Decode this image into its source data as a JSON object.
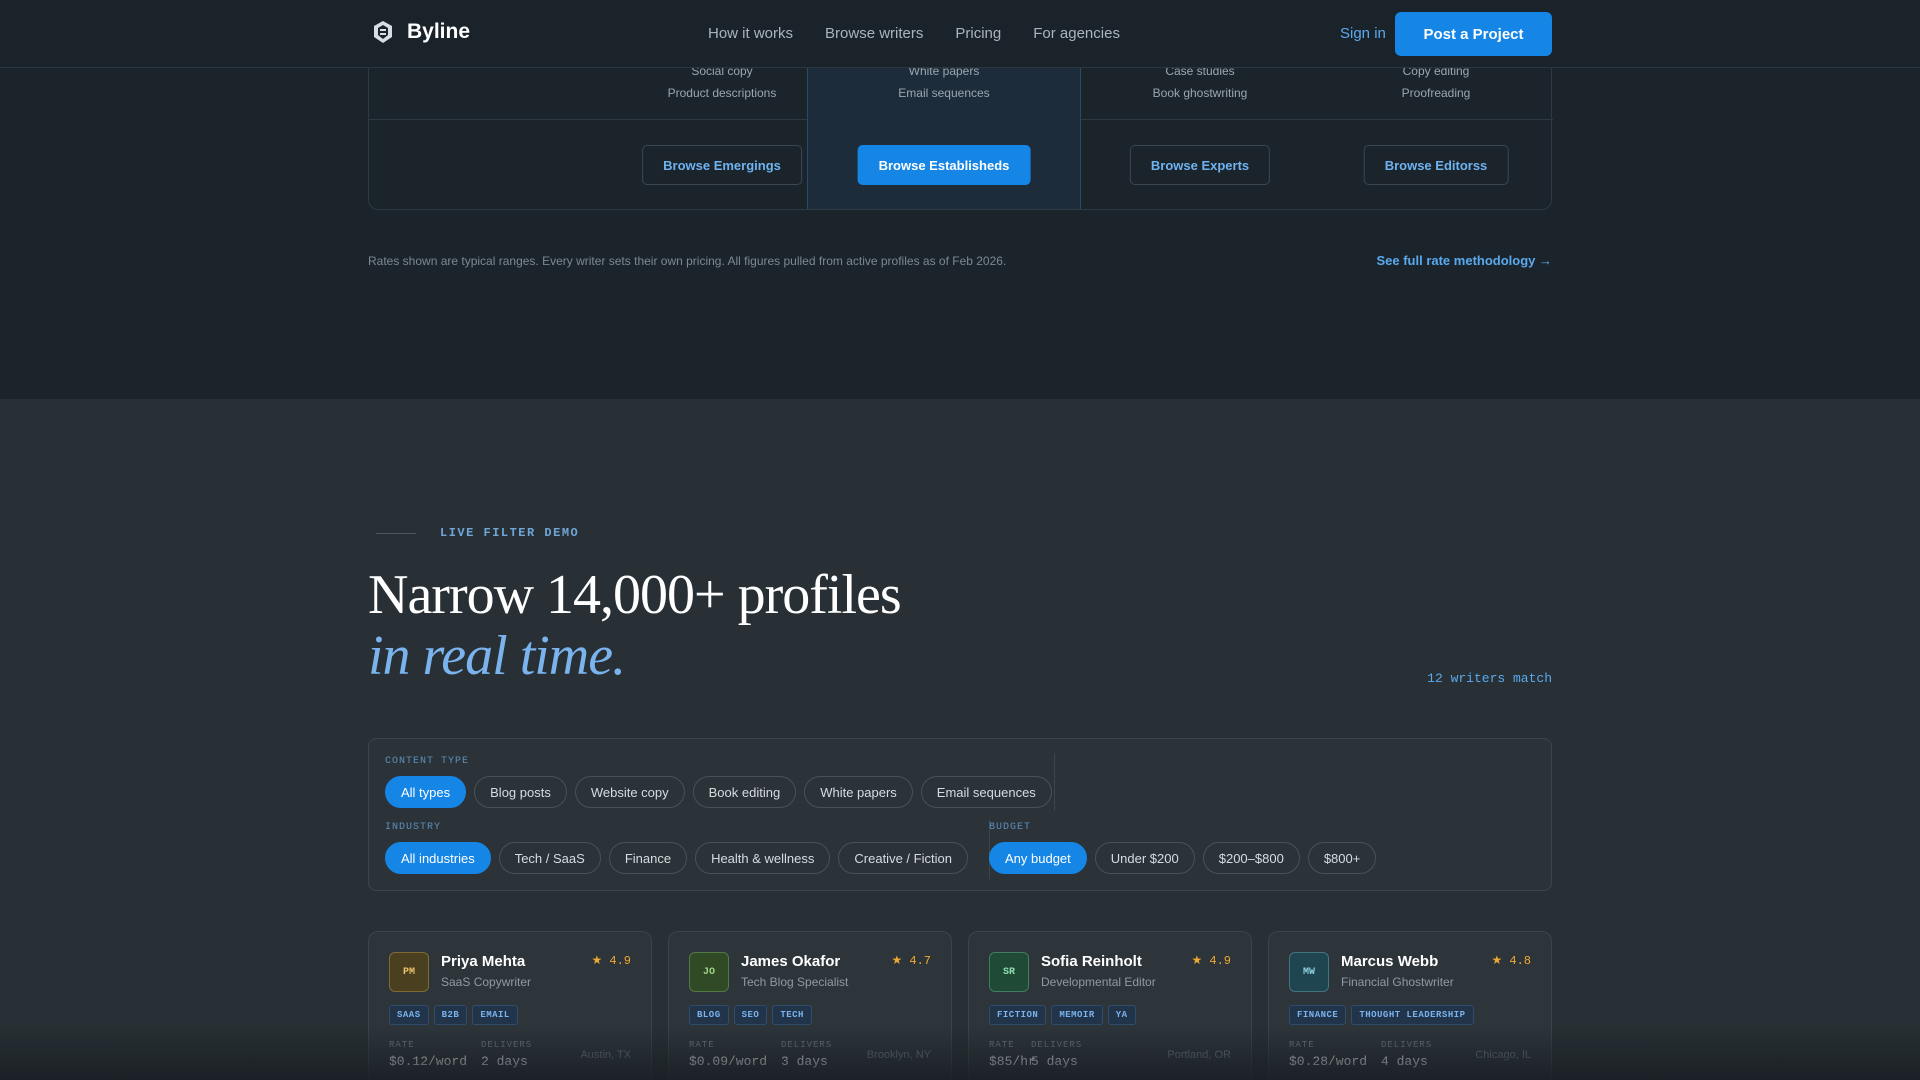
{
  "nav": {
    "brand": "Byline",
    "links": [
      "How it works",
      "Browse writers",
      "Pricing",
      "For agencies"
    ],
    "signin": "Sign in",
    "cta": "Post a Project"
  },
  "pricing": {
    "tiers": [
      {
        "feature1": "Social copy",
        "feature2": "Product descriptions",
        "button": "Browse Emergings"
      },
      {
        "feature1": "White papers",
        "feature2": "Email sequences",
        "button": "Browse Establisheds"
      },
      {
        "feature1": "Case studies",
        "feature2": "Book ghostwriting",
        "button": "Browse Experts"
      },
      {
        "feature1": "Copy editing",
        "feature2": "Proofreading",
        "button": "Browse Editorss"
      }
    ],
    "note": "Rates shown are typical ranges. Every writer sets their own pricing. All figures pulled from active profiles as of Feb 2026.",
    "methodology_link": "See full rate methodology →"
  },
  "demo": {
    "eyebrow": "LIVE FILTER DEMO",
    "headline": "Narrow 14,000+ profiles",
    "headline_italic": "in real time.",
    "match_count": "12 writers match",
    "filters": {
      "content_type": {
        "label": "CONTENT TYPE",
        "options": [
          "All types",
          "Blog posts",
          "Website copy",
          "Book editing",
          "White papers",
          "Email sequences"
        ]
      },
      "industry": {
        "label": "INDUSTRY",
        "options": [
          "All industries",
          "Tech / SaaS",
          "Finance",
          "Health & wellness",
          "Creative / Fiction"
        ]
      },
      "budget": {
        "label": "BUDGET",
        "options": [
          "Any budget",
          "Under $200",
          "$200–$800",
          "$800+"
        ]
      }
    }
  },
  "writers": [
    {
      "initials": "PM",
      "name": "Priya Mehta",
      "role": "SaaS Copywriter",
      "rating": "★ 4.9",
      "tags": [
        "SAAS",
        "B2B",
        "EMAIL"
      ],
      "rate_label": "RATE",
      "rate": "$0.12/word",
      "delivers_label": "DELIVERS",
      "delivers": "2 days",
      "location": "Austin, TX",
      "avatar_bg": "#4a4020",
      "avatar_fg": "#e8c36a"
    },
    {
      "initials": "JO",
      "name": "James Okafor",
      "role": "Tech Blog Specialist",
      "rating": "★ 4.7",
      "tags": [
        "BLOG",
        "SEO",
        "TECH"
      ],
      "rate_label": "RATE",
      "rate": "$0.09/word",
      "delivers_label": "DELIVERS",
      "delivers": "3 days",
      "location": "Brooklyn, NY",
      "avatar_bg": "#2f4a25",
      "avatar_fg": "#9fd48a"
    },
    {
      "initials": "SR",
      "name": "Sofia Reinholt",
      "role": "Developmental Editor",
      "rating": "★ 4.9",
      "tags": [
        "FICTION",
        "MEMOIR",
        "YA"
      ],
      "rate_label": "RATE",
      "rate": "$85/hr",
      "delivers_label": "DELIVERS",
      "delivers": "5 days",
      "location": "Portland, OR",
      "avatar_bg": "#1f4a35",
      "avatar_fg": "#8ee0b4"
    },
    {
      "initials": "MW",
      "name": "Marcus Webb",
      "role": "Financial Ghostwriter",
      "rating": "★ 4.8",
      "tags": [
        "FINANCE",
        "THOUGHT LEADERSHIP"
      ],
      "rate_label": "RATE",
      "rate": "$0.28/word",
      "delivers_label": "DELIVERS",
      "delivers": "4 days",
      "location": "Chicago, IL",
      "avatar_bg": "#1f4650",
      "avatar_fg": "#8fd2e0"
    }
  ]
}
